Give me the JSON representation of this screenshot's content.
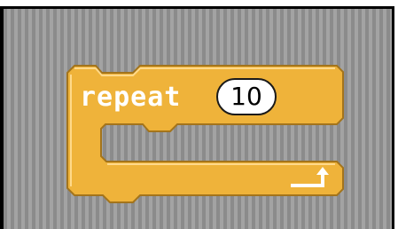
{
  "block": {
    "label": "repeat",
    "count": "10"
  },
  "colors": {
    "block_fill": "#f0b43c",
    "block_edge": "#a3741c",
    "highlight": "#ffd97a",
    "stripe_light": "#a6a6a6",
    "stripe_dark": "#8a8a8a",
    "border": "#000000"
  },
  "icons": {
    "loop_arrow": "loop-arrow-icon"
  }
}
